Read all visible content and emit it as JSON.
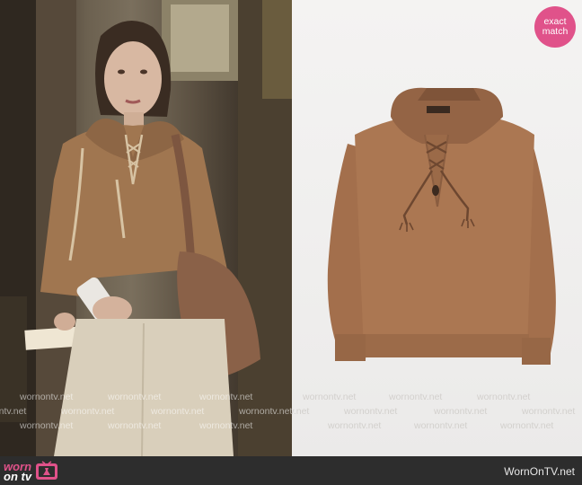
{
  "badge": {
    "line1": "exact",
    "line2": "match"
  },
  "watermark": "wornontv.net",
  "footer": {
    "logo_top": "worn",
    "logo_bottom": "on tv",
    "site_url": "WornOnTV.net"
  },
  "colors": {
    "badge_pink": "#e0528a",
    "footer_bg": "#2d2d2d",
    "sweater_camel": "#a8744f",
    "product_bg": "#f1f0ef"
  }
}
